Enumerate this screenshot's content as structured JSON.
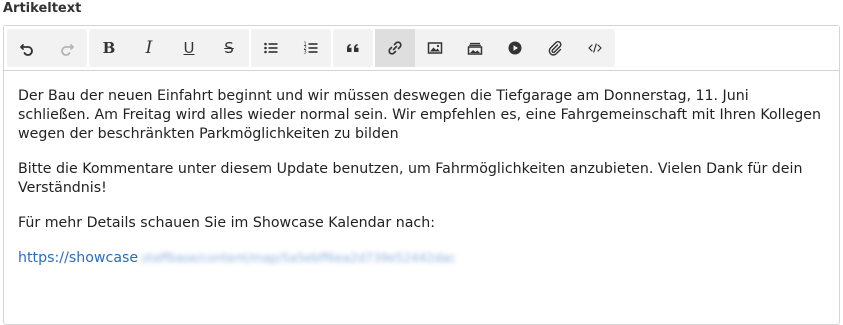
{
  "field": {
    "label": "Artikeltext"
  },
  "toolbar": {
    "groups": [
      [
        {
          "icon": "undo-icon",
          "name": "undo-button",
          "state": "enabled"
        },
        {
          "icon": "redo-icon",
          "name": "redo-button",
          "state": "disabled"
        }
      ],
      [
        {
          "icon": "bold-icon",
          "name": "bold-button",
          "glyph": "B"
        },
        {
          "icon": "italic-icon",
          "name": "italic-button",
          "glyph": "I"
        },
        {
          "icon": "underline-icon",
          "name": "underline-button",
          "glyph": "U"
        },
        {
          "icon": "strikethrough-icon",
          "name": "strikethrough-button",
          "glyph": "S"
        }
      ],
      [
        {
          "icon": "bullet-list-icon",
          "name": "bullet-list-button"
        },
        {
          "icon": "numbered-list-icon",
          "name": "numbered-list-button"
        }
      ],
      [
        {
          "icon": "blockquote-icon",
          "name": "blockquote-button"
        }
      ],
      [
        {
          "icon": "link-icon",
          "name": "link-button",
          "state": "active"
        },
        {
          "icon": "image-icon",
          "name": "image-button"
        },
        {
          "icon": "gallery-icon",
          "name": "gallery-button"
        },
        {
          "icon": "video-icon",
          "name": "video-button"
        },
        {
          "icon": "attachment-icon",
          "name": "attachment-button"
        },
        {
          "icon": "code-icon",
          "name": "code-button"
        }
      ]
    ]
  },
  "content": {
    "paragraph1": "Der Bau der neuen Einfahrt beginnt und wir müssen deswegen die Tiefgarage am Donnerstag, 11. Juni schließen. Am Freitag wird alles wieder normal sein. Wir empfehlen es, eine Fahrgemeinschaft mit Ihren Kollegen wegen der beschränkten Parkmöglichkeiten zu bilden",
    "paragraph2": "Bitte die Kommentare unter diesem Update benutzen, um Fahrmöglichkeiten anzubieten. Vielen Dank für dein Verständnis!",
    "paragraph3": "Für mehr Details schauen Sie im Showcase Kalendar nach:",
    "link_visible": "https://showcase",
    "link_blurred": ".staffbase/content/map/5a5ebff6ea2d739e52442dac"
  },
  "colors": {
    "link": "#2a6dba",
    "toolbar_group_bg": "#f2f2f2",
    "active_button_bg": "#dedede",
    "border": "#d4d4d4"
  }
}
